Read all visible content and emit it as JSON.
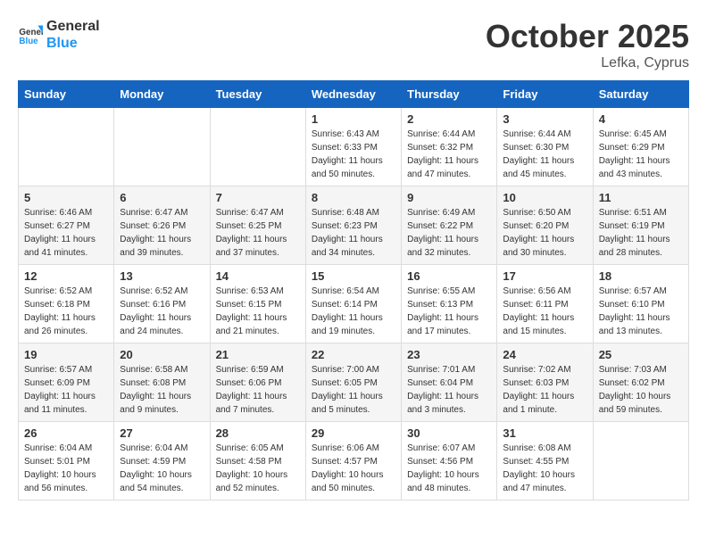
{
  "header": {
    "logo_line1": "General",
    "logo_line2": "Blue",
    "month": "October 2025",
    "location": "Lefka, Cyprus"
  },
  "weekdays": [
    "Sunday",
    "Monday",
    "Tuesday",
    "Wednesday",
    "Thursday",
    "Friday",
    "Saturday"
  ],
  "weeks": [
    [
      {
        "day": "",
        "info": ""
      },
      {
        "day": "",
        "info": ""
      },
      {
        "day": "",
        "info": ""
      },
      {
        "day": "1",
        "info": "Sunrise: 6:43 AM\nSunset: 6:33 PM\nDaylight: 11 hours\nand 50 minutes."
      },
      {
        "day": "2",
        "info": "Sunrise: 6:44 AM\nSunset: 6:32 PM\nDaylight: 11 hours\nand 47 minutes."
      },
      {
        "day": "3",
        "info": "Sunrise: 6:44 AM\nSunset: 6:30 PM\nDaylight: 11 hours\nand 45 minutes."
      },
      {
        "day": "4",
        "info": "Sunrise: 6:45 AM\nSunset: 6:29 PM\nDaylight: 11 hours\nand 43 minutes."
      }
    ],
    [
      {
        "day": "5",
        "info": "Sunrise: 6:46 AM\nSunset: 6:27 PM\nDaylight: 11 hours\nand 41 minutes."
      },
      {
        "day": "6",
        "info": "Sunrise: 6:47 AM\nSunset: 6:26 PM\nDaylight: 11 hours\nand 39 minutes."
      },
      {
        "day": "7",
        "info": "Sunrise: 6:47 AM\nSunset: 6:25 PM\nDaylight: 11 hours\nand 37 minutes."
      },
      {
        "day": "8",
        "info": "Sunrise: 6:48 AM\nSunset: 6:23 PM\nDaylight: 11 hours\nand 34 minutes."
      },
      {
        "day": "9",
        "info": "Sunrise: 6:49 AM\nSunset: 6:22 PM\nDaylight: 11 hours\nand 32 minutes."
      },
      {
        "day": "10",
        "info": "Sunrise: 6:50 AM\nSunset: 6:20 PM\nDaylight: 11 hours\nand 30 minutes."
      },
      {
        "day": "11",
        "info": "Sunrise: 6:51 AM\nSunset: 6:19 PM\nDaylight: 11 hours\nand 28 minutes."
      }
    ],
    [
      {
        "day": "12",
        "info": "Sunrise: 6:52 AM\nSunset: 6:18 PM\nDaylight: 11 hours\nand 26 minutes."
      },
      {
        "day": "13",
        "info": "Sunrise: 6:52 AM\nSunset: 6:16 PM\nDaylight: 11 hours\nand 24 minutes."
      },
      {
        "day": "14",
        "info": "Sunrise: 6:53 AM\nSunset: 6:15 PM\nDaylight: 11 hours\nand 21 minutes."
      },
      {
        "day": "15",
        "info": "Sunrise: 6:54 AM\nSunset: 6:14 PM\nDaylight: 11 hours\nand 19 minutes."
      },
      {
        "day": "16",
        "info": "Sunrise: 6:55 AM\nSunset: 6:13 PM\nDaylight: 11 hours\nand 17 minutes."
      },
      {
        "day": "17",
        "info": "Sunrise: 6:56 AM\nSunset: 6:11 PM\nDaylight: 11 hours\nand 15 minutes."
      },
      {
        "day": "18",
        "info": "Sunrise: 6:57 AM\nSunset: 6:10 PM\nDaylight: 11 hours\nand 13 minutes."
      }
    ],
    [
      {
        "day": "19",
        "info": "Sunrise: 6:57 AM\nSunset: 6:09 PM\nDaylight: 11 hours\nand 11 minutes."
      },
      {
        "day": "20",
        "info": "Sunrise: 6:58 AM\nSunset: 6:08 PM\nDaylight: 11 hours\nand 9 minutes."
      },
      {
        "day": "21",
        "info": "Sunrise: 6:59 AM\nSunset: 6:06 PM\nDaylight: 11 hours\nand 7 minutes."
      },
      {
        "day": "22",
        "info": "Sunrise: 7:00 AM\nSunset: 6:05 PM\nDaylight: 11 hours\nand 5 minutes."
      },
      {
        "day": "23",
        "info": "Sunrise: 7:01 AM\nSunset: 6:04 PM\nDaylight: 11 hours\nand 3 minutes."
      },
      {
        "day": "24",
        "info": "Sunrise: 7:02 AM\nSunset: 6:03 PM\nDaylight: 11 hours\nand 1 minute."
      },
      {
        "day": "25",
        "info": "Sunrise: 7:03 AM\nSunset: 6:02 PM\nDaylight: 10 hours\nand 59 minutes."
      }
    ],
    [
      {
        "day": "26",
        "info": "Sunrise: 6:04 AM\nSunset: 5:01 PM\nDaylight: 10 hours\nand 56 minutes."
      },
      {
        "day": "27",
        "info": "Sunrise: 6:04 AM\nSunset: 4:59 PM\nDaylight: 10 hours\nand 54 minutes."
      },
      {
        "day": "28",
        "info": "Sunrise: 6:05 AM\nSunset: 4:58 PM\nDaylight: 10 hours\nand 52 minutes."
      },
      {
        "day": "29",
        "info": "Sunrise: 6:06 AM\nSunset: 4:57 PM\nDaylight: 10 hours\nand 50 minutes."
      },
      {
        "day": "30",
        "info": "Sunrise: 6:07 AM\nSunset: 4:56 PM\nDaylight: 10 hours\nand 48 minutes."
      },
      {
        "day": "31",
        "info": "Sunrise: 6:08 AM\nSunset: 4:55 PM\nDaylight: 10 hours\nand 47 minutes."
      },
      {
        "day": "",
        "info": ""
      }
    ]
  ]
}
